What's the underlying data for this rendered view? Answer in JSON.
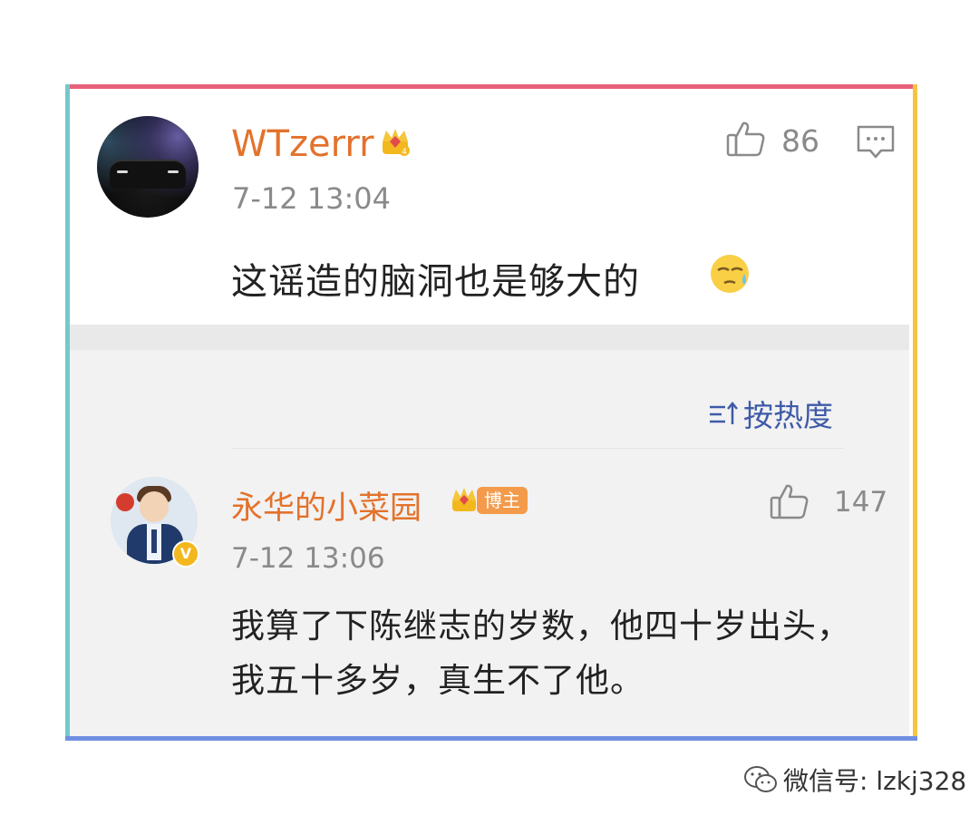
{
  "comment": {
    "username": "WTzerrr",
    "user_badge_icon": "crown-level-icon",
    "timestamp": "7-12 13:04",
    "text": "这谣造的脑洞也是够大的",
    "emoji_icon": "sweat-face-emoji",
    "like_count": "86",
    "like_icon": "thumbs-up-icon",
    "reply_icon": "comment-icon"
  },
  "sort": {
    "label": "按热度",
    "icon": "sort-icon"
  },
  "reply": {
    "username": "永华的小菜园",
    "badge_label": "博主",
    "verified_icon": "verified-v-icon",
    "verified_text": "V",
    "timestamp": "7-12 13:06",
    "text": "我算了下陈继志的岁数，他四十岁出头，我五十多岁，真生不了他。",
    "like_count": "147",
    "like_icon": "thumbs-up-icon"
  },
  "watermark": {
    "text": "微信号: lzkj328",
    "icon": "wechat-icon"
  },
  "colors": {
    "username": "#e3722b",
    "sort_link": "#3f5aa8",
    "border_top": "#e8607a",
    "border_left": "#74c9cc",
    "border_right": "#f5c542",
    "border_bottom": "#6f8fe0"
  }
}
